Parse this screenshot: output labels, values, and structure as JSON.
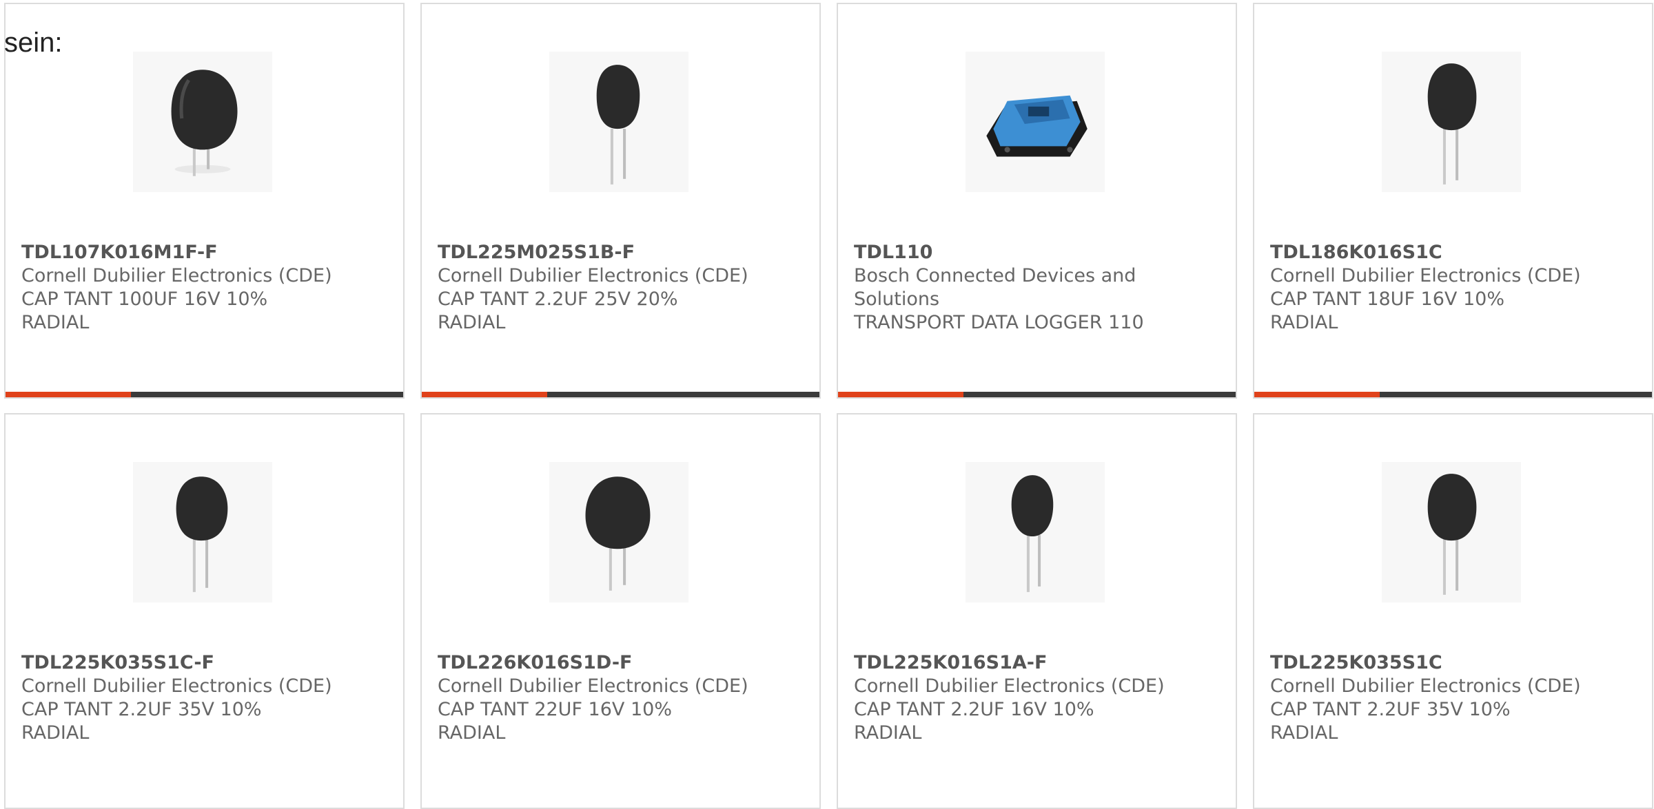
{
  "intro_text": "sein:",
  "colors": {
    "accent": "#e0421b",
    "bar": "#3a3a3a",
    "border": "#dcdcdc"
  },
  "products": [
    {
      "part_number": "TDL107K016M1F-F",
      "manufacturer": "Cornell Dubilier Electronics (CDE)",
      "description": "CAP TANT 100UF 16V 10%",
      "package": "RADIAL",
      "image": "radial-capacitor-icon"
    },
    {
      "part_number": "TDL225M025S1B-F",
      "manufacturer": "Cornell Dubilier Electronics (CDE)",
      "description": "CAP TANT 2.2UF 25V 20%",
      "package": "RADIAL",
      "image": "radial-capacitor-icon"
    },
    {
      "part_number": "TDL110",
      "manufacturer": "Bosch Connected Devices and Solutions",
      "description": "TRANSPORT DATA LOGGER 110",
      "package": "",
      "image": "data-logger-icon"
    },
    {
      "part_number": "TDL186K016S1C",
      "manufacturer": "Cornell Dubilier Electronics (CDE)",
      "description": "CAP TANT 18UF 16V 10%",
      "package": "RADIAL",
      "image": "radial-capacitor-icon"
    },
    {
      "part_number": "TDL225K035S1C-F",
      "manufacturer": "Cornell Dubilier Electronics (CDE)",
      "description": "CAP TANT 2.2UF 35V 10%",
      "package": "RADIAL",
      "image": "radial-capacitor-icon"
    },
    {
      "part_number": "TDL226K016S1D-F",
      "manufacturer": "Cornell Dubilier Electronics (CDE)",
      "description": "CAP TANT 22UF 16V 10%",
      "package": "RADIAL",
      "image": "radial-capacitor-icon"
    },
    {
      "part_number": "TDL225K016S1A-F",
      "manufacturer": "Cornell Dubilier Electronics (CDE)",
      "description": "CAP TANT 2.2UF 16V 10%",
      "package": "RADIAL",
      "image": "radial-capacitor-icon"
    },
    {
      "part_number": "TDL225K035S1C",
      "manufacturer": "Cornell Dubilier Electronics (CDE)",
      "description": "CAP TANT 2.2UF 35V 10%",
      "package": "RADIAL",
      "image": "radial-capacitor-icon"
    }
  ]
}
